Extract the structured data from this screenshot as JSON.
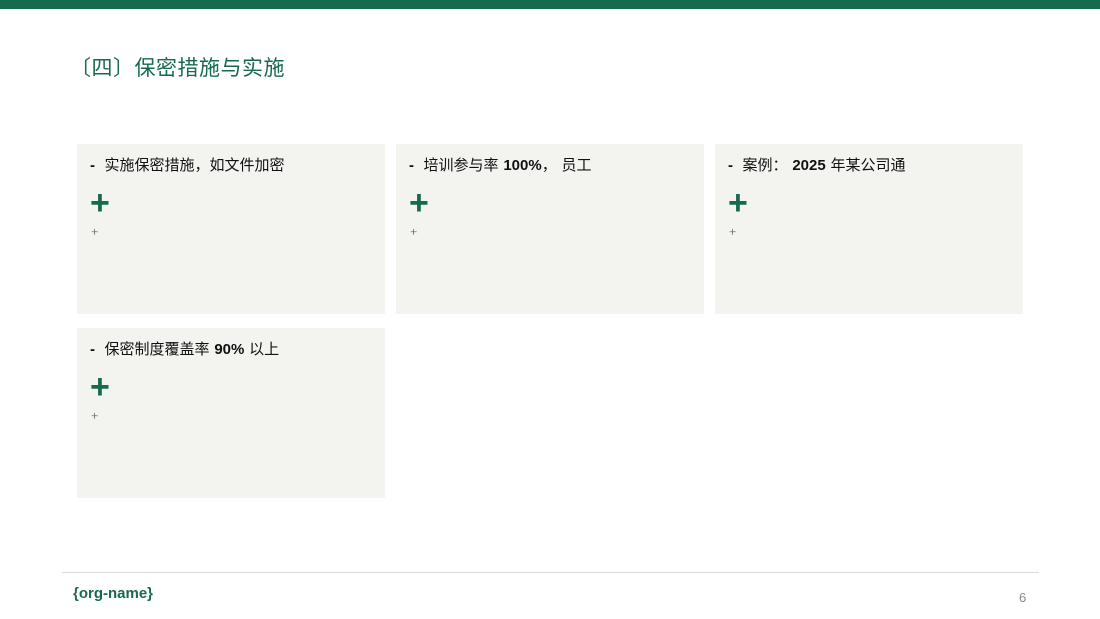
{
  "slide": {
    "title": "〔四〕保密措施与实施",
    "cards": [
      {
        "dash": "-",
        "text_pre": "实施保密措施，如文件加密",
        "text_bold": "",
        "text_post": "",
        "plus_big": "+",
        "plus_small": "+"
      },
      {
        "dash": "-",
        "text_pre": "培训参与率 ",
        "text_bold": "100%",
        "text_post": "， 员工",
        "plus_big": "+",
        "plus_small": "+"
      },
      {
        "dash": "-",
        "text_pre": "案例： ",
        "text_bold": "2025",
        "text_post": " 年某公司通",
        "plus_big": "+",
        "plus_small": "+"
      },
      {
        "dash": "-",
        "text_pre": "保密制度覆盖率 ",
        "text_bold": "90%",
        "text_post": " 以上",
        "plus_big": "+",
        "plus_small": "+"
      }
    ]
  },
  "footer": {
    "org_name": "{org-name}",
    "page_number": "6"
  },
  "colors": {
    "accent": "#186a4e",
    "card_background": "#f3f3f0"
  }
}
